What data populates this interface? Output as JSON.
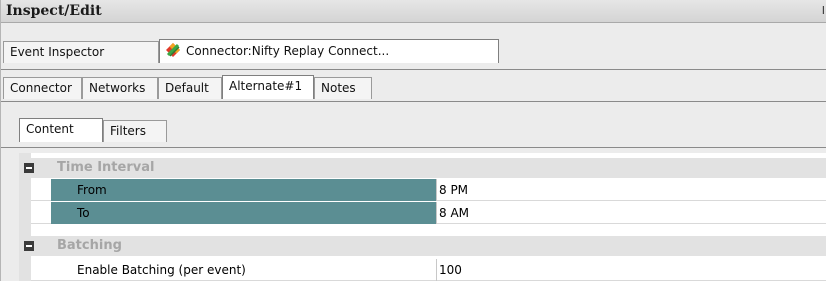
{
  "panel": {
    "title": "Inspect/Edit",
    "corner_glyph": "I"
  },
  "top_tabs": [
    {
      "label": "Event Inspector",
      "active": false
    },
    {
      "label": "Connector:Nifty Replay Connect...",
      "active": true,
      "icon": "connector-diamond-icon"
    }
  ],
  "connector_tabs": [
    {
      "label": "Connector",
      "active": false
    },
    {
      "label": "Networks",
      "active": false
    },
    {
      "label": "Default",
      "active": false
    },
    {
      "label": "Alternate#1",
      "active": true
    },
    {
      "label": "Notes",
      "active": false
    }
  ],
  "content_tabs": [
    {
      "label": "Content",
      "active": true
    },
    {
      "label": "Filters",
      "active": false
    }
  ],
  "properties": {
    "time_interval": {
      "label": "Time Interval",
      "from": {
        "name": "From",
        "value": "8 PM"
      },
      "to": {
        "name": "To",
        "value": "8 AM"
      }
    },
    "batching": {
      "label": "Batching",
      "enable": {
        "name": "Enable Batching (per event)",
        "value": "100"
      }
    }
  },
  "colors": {
    "selected_row": "#5b8e93",
    "category_text": "#a6a6a6"
  }
}
